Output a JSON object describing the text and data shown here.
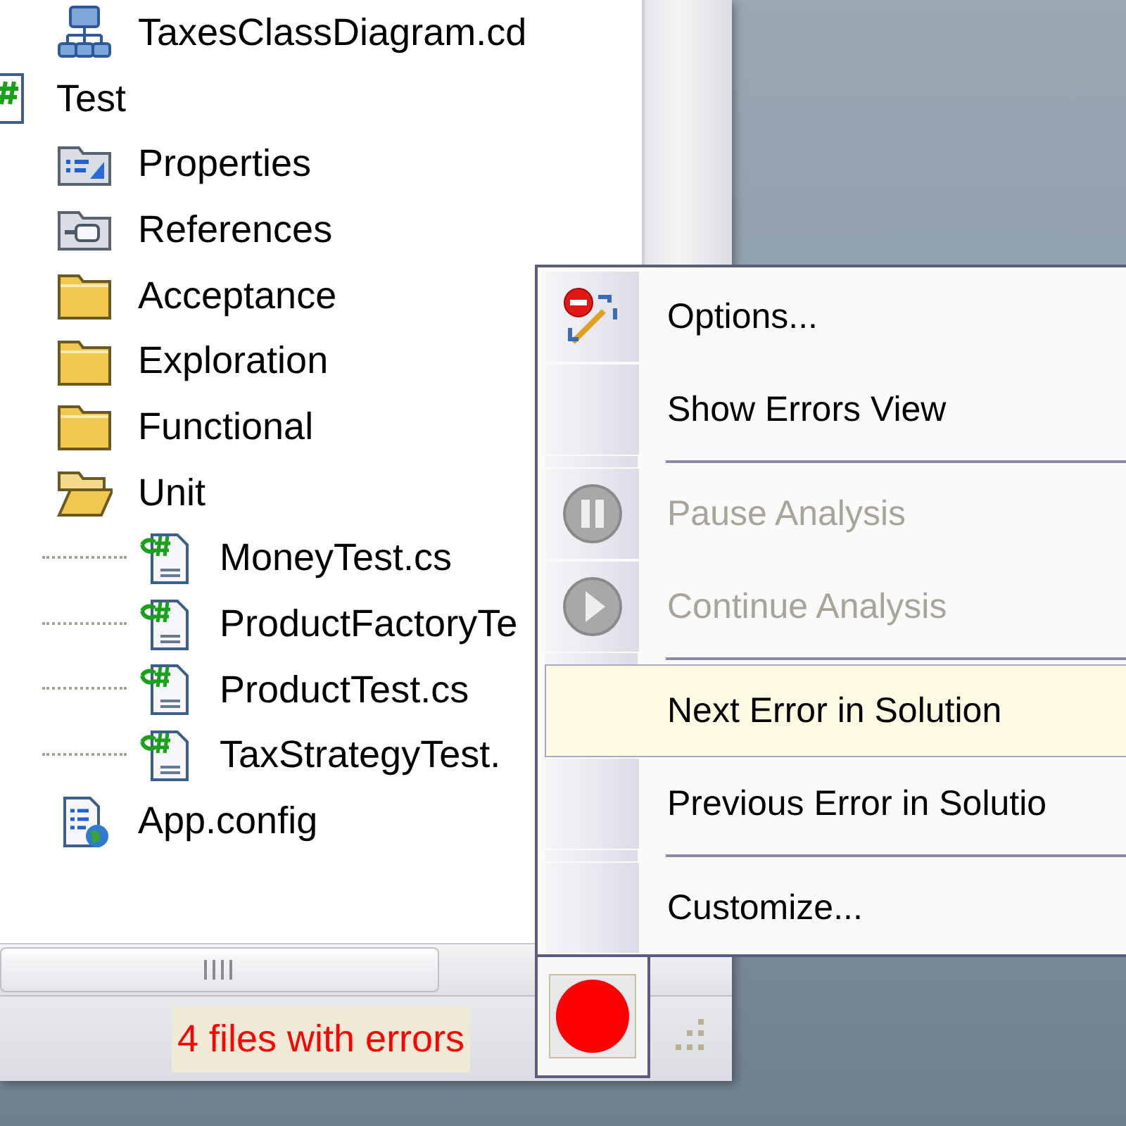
{
  "tree": {
    "items": [
      {
        "children": [
          {
            "label": "TaxesClassDiagram.cd",
            "kind": "diagram"
          }
        ]
      },
      {
        "label": "Test",
        "kind": "project",
        "children": [
          {
            "label": "Properties",
            "kind": "properties"
          },
          {
            "label": "References",
            "kind": "references"
          },
          {
            "label": "Acceptance",
            "kind": "folder",
            "expanded": false
          },
          {
            "label": "Exploration",
            "kind": "folder",
            "expanded": false
          },
          {
            "label": "Functional",
            "kind": "folder",
            "expanded": false
          },
          {
            "label": "Unit",
            "kind": "folder",
            "expanded": true,
            "children": [
              {
                "label": "MoneyTest.cs",
                "kind": "csharp"
              },
              {
                "label": "ProductFactoryTe",
                "kind": "csharp"
              },
              {
                "label": "ProductTest.cs",
                "kind": "csharp"
              },
              {
                "label": "TaxStrategyTest.",
                "kind": "csharp"
              }
            ]
          },
          {
            "label": "App.config",
            "kind": "config"
          }
        ]
      }
    ]
  },
  "status_bar": {
    "text": "4 files with errors"
  },
  "menu": {
    "items": [
      {
        "kind": "settings",
        "label": "Options...",
        "disabled": false,
        "highlighted": false
      },
      {
        "kind": "plain",
        "label": "Show Errors View",
        "disabled": false,
        "highlighted": false
      },
      {
        "kind": "separator"
      },
      {
        "kind": "pause",
        "label": "Pause Analysis",
        "disabled": true,
        "highlighted": false
      },
      {
        "kind": "resume",
        "label": "Continue Analysis",
        "disabled": true,
        "highlighted": false
      },
      {
        "kind": "separator"
      },
      {
        "kind": "plain",
        "label": "Next Error in Solution",
        "disabled": false,
        "highlighted": true
      },
      {
        "kind": "plain",
        "label": "Previous Error in Solutio",
        "disabled": false,
        "highlighted": false
      },
      {
        "kind": "separator"
      },
      {
        "kind": "plain",
        "label": "Customize...",
        "disabled": false,
        "highlighted": false
      }
    ]
  }
}
